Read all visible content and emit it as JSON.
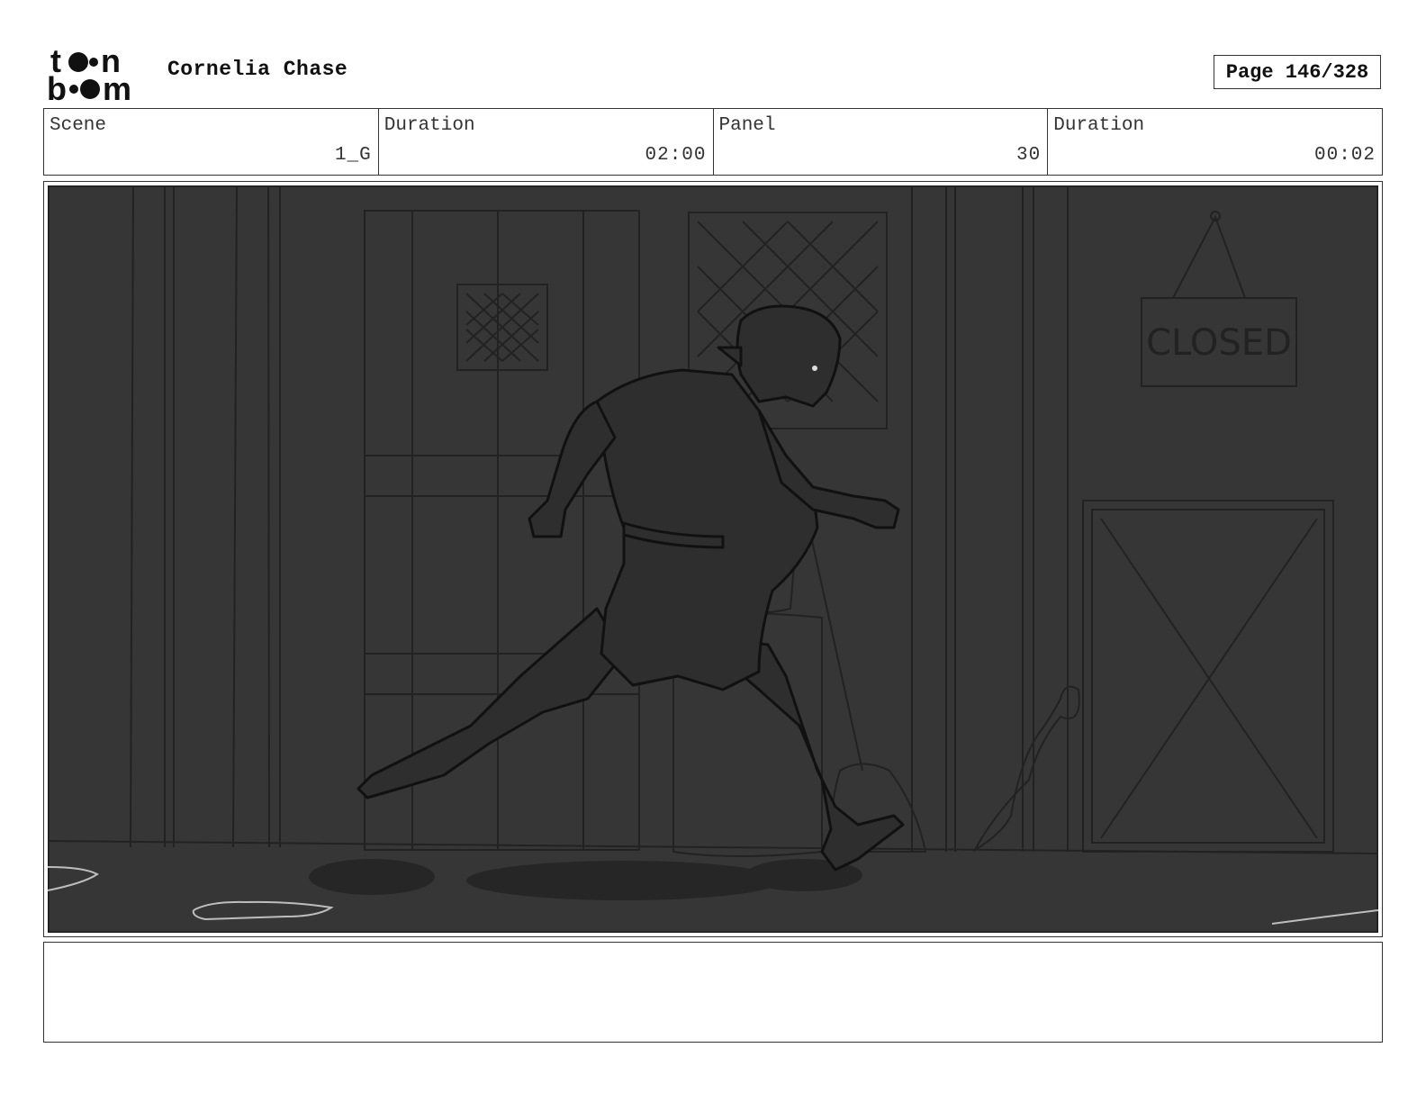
{
  "header": {
    "logo_text": "toon boom",
    "title": "Cornelia Chase",
    "page_label": "Page 146/328"
  },
  "info": [
    {
      "label": "Scene",
      "value": "1_G"
    },
    {
      "label": "Duration",
      "value": "02:00"
    },
    {
      "label": "Panel",
      "value": "30"
    },
    {
      "label": "Duration",
      "value": "00:02"
    }
  ],
  "panel": {
    "sign_text": "CLOSED",
    "background_color": "#363636"
  },
  "caption": {
    "text": ""
  }
}
